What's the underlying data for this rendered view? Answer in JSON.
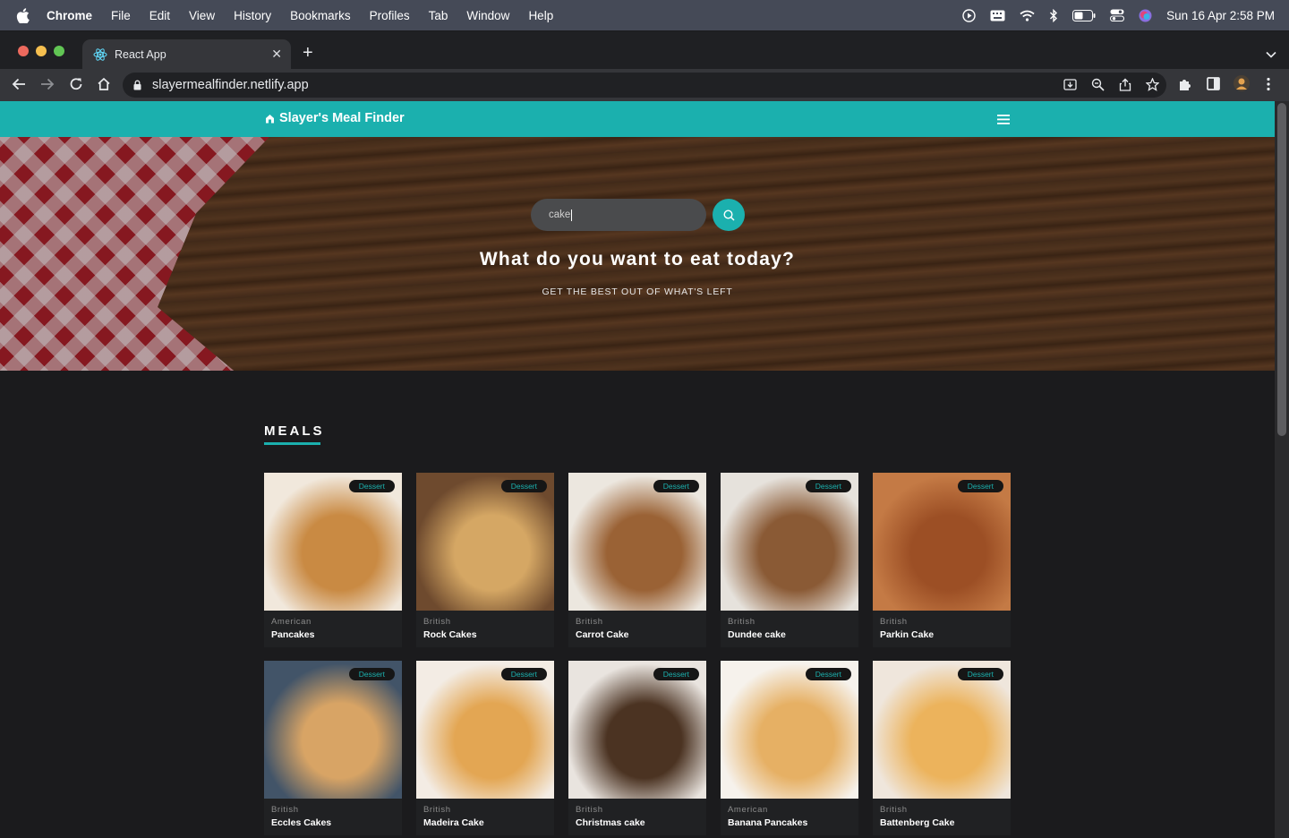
{
  "menubar": {
    "app": "Chrome",
    "items": [
      "File",
      "Edit",
      "View",
      "History",
      "Bookmarks",
      "Profiles",
      "Tab",
      "Window",
      "Help"
    ],
    "datetime": "Sun 16 Apr  2:58 PM"
  },
  "browser": {
    "tab_title": "React App",
    "url": "slayermealfinder.netlify.app"
  },
  "app": {
    "brand": "Slayer's Meal Finder",
    "search": {
      "value": "cake",
      "placeholder": ""
    },
    "hero_title": "What do you want to eat today?",
    "hero_subtitle": "GET THE BEST OUT OF WHAT'S LEFT",
    "section_title": "MEALS",
    "meals": [
      {
        "category": "Dessert",
        "area": "American",
        "name": "Pancakes",
        "c1": "#c98a43",
        "c2": "#f1e8dc"
      },
      {
        "category": "Dessert",
        "area": "British",
        "name": "Rock Cakes",
        "c1": "#d5a764",
        "c2": "#6e4a2e"
      },
      {
        "category": "Dessert",
        "area": "British",
        "name": "Carrot Cake",
        "c1": "#9a6235",
        "c2": "#ece7df"
      },
      {
        "category": "Dessert",
        "area": "British",
        "name": "Dundee cake",
        "c1": "#8a5a35",
        "c2": "#e6e2dc"
      },
      {
        "category": "Dessert",
        "area": "British",
        "name": "Parkin Cake",
        "c1": "#9c4f25",
        "c2": "#c47a45"
      },
      {
        "category": "Dessert",
        "area": "British",
        "name": "Eccles Cakes",
        "c1": "#d8a465",
        "c2": "#425468"
      },
      {
        "category": "Dessert",
        "area": "British",
        "name": "Madeira Cake",
        "c1": "#e3a653",
        "c2": "#f3ece4"
      },
      {
        "category": "Dessert",
        "area": "British",
        "name": "Christmas cake",
        "c1": "#4b3322",
        "c2": "#e9e4df"
      },
      {
        "category": "Dessert",
        "area": "American",
        "name": "Banana Pancakes",
        "c1": "#e6b064",
        "c2": "#f6f2ec"
      },
      {
        "category": "Dessert",
        "area": "British",
        "name": "Battenberg Cake",
        "c1": "#ecb35c",
        "c2": "#efe6dc"
      }
    ]
  }
}
